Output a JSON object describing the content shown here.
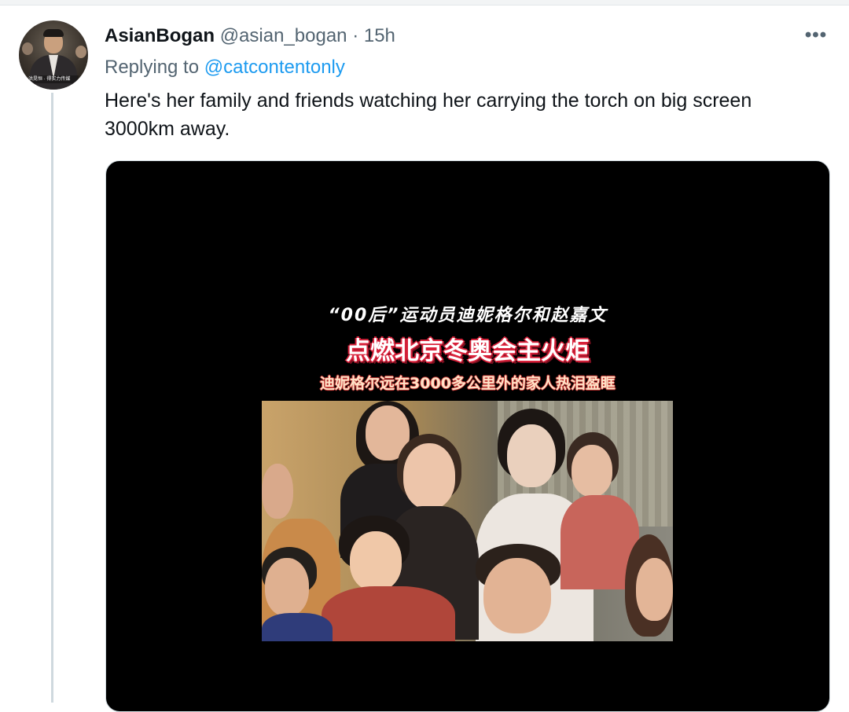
{
  "tweet": {
    "display_name": "AsianBogan",
    "handle": "@asian_bogan",
    "separator": "·",
    "time": "15h",
    "more_label": "•••",
    "replying_prefix": "Replying to",
    "replying_to": "@catcontentonly",
    "text": "Here's her family and friends watching her carrying the torch on big screen 3000km away."
  },
  "avatar": {
    "icon": "profile-photo",
    "caption": "洪晃恒 · 得实力传媒"
  },
  "media": {
    "overlay_line1": "“00后”运动员迪妮格尔和赵嘉文",
    "overlay_line2": "点燃北京冬奥会主火炬",
    "overlay_line3": "迪妮格尔远在3000多公里外的家人热泪盈眶",
    "background": "#000000",
    "photo_description_icon": "family-watching-photo"
  },
  "colors": {
    "link": "#1d9bf0",
    "secondary_text": "#536471",
    "primary_text": "#0f1419",
    "thread_line": "#cfd9de"
  }
}
